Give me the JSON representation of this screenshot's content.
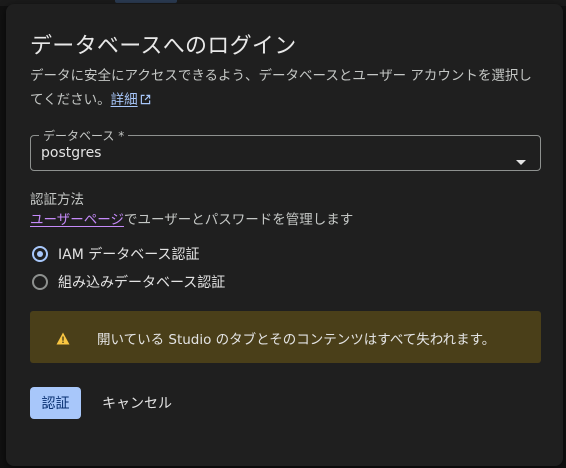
{
  "dialog": {
    "title": "データベースへのログイン",
    "description": "データに安全にアクセスできるよう、データベースとユーザー アカウントを選択してください。",
    "details_link": "詳細"
  },
  "database_select": {
    "label": "データベース *",
    "value": "postgres"
  },
  "auth": {
    "heading": "認証方法",
    "user_page_link": "ユーザーページ",
    "user_page_note": "でユーザーとパスワードを管理します",
    "options": [
      {
        "label": "IAM データベース認証",
        "selected": true
      },
      {
        "label": "組み込みデータベース認証",
        "selected": false
      }
    ]
  },
  "warning": {
    "icon": "warning-icon",
    "color": "#4a3f19",
    "text": "開いている Studio のタブとそのコンテンツはすべて失われます。"
  },
  "actions": {
    "authenticate_label": "認証",
    "cancel_label": "キャンセル"
  },
  "colors": {
    "accent": "#a8c7fa",
    "visited_link": "#c58af9",
    "warning_icon": "#f9c642"
  }
}
